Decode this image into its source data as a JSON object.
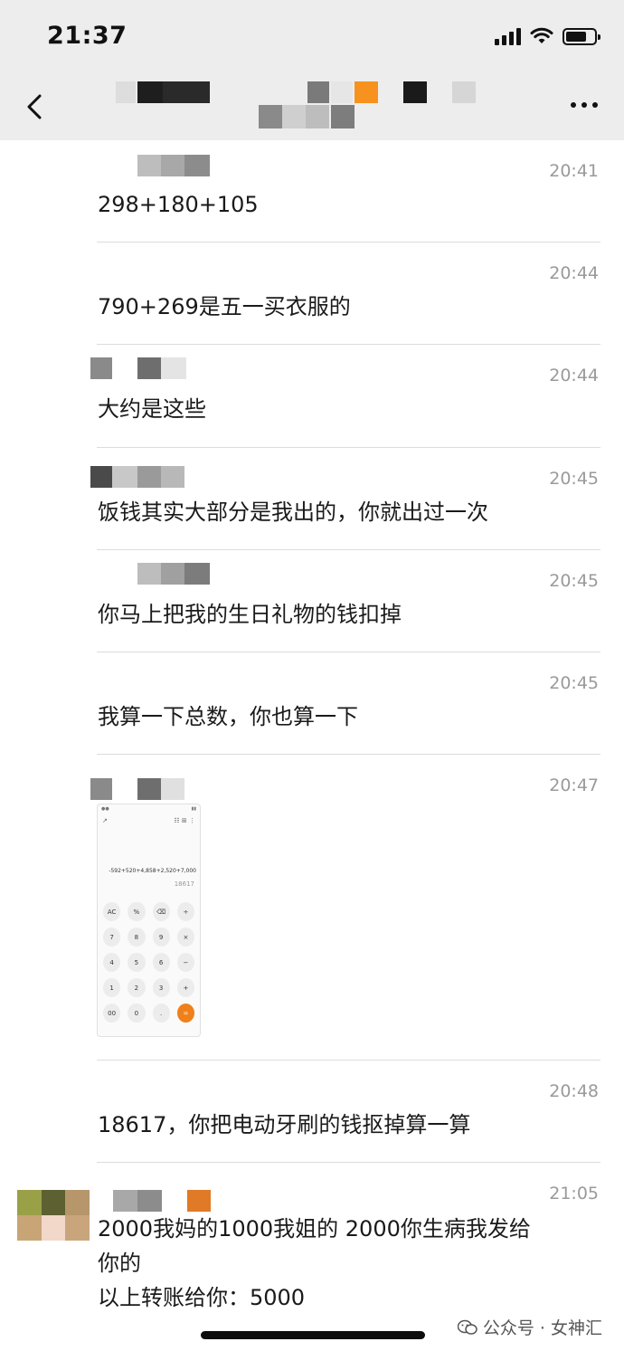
{
  "status_bar": {
    "time": "21:37"
  },
  "nav": {
    "back_icon": "chevron-left-icon",
    "more_icon": "ellipsis-icon"
  },
  "messages": [
    {
      "time": "20:41",
      "text": "298+180+105"
    },
    {
      "time": "20:44",
      "text": "790+269是五一买衣服的"
    },
    {
      "time": "20:44",
      "text": "大约是这些"
    },
    {
      "time": "20:45",
      "text": "饭钱其实大部分是我出的，你就出过一次"
    },
    {
      "time": "20:45",
      "text": "你马上把我的生日礼物的钱扣掉"
    },
    {
      "time": "20:45",
      "text": "我算一下总数，你也算一下"
    },
    {
      "time": "20:47",
      "image": {
        "expression": "-592+520+4,858+2,520+7,000",
        "result": "18617",
        "keys": [
          "AC",
          "%",
          "⌫",
          "÷",
          "7",
          "8",
          "9",
          "×",
          "4",
          "5",
          "6",
          "−",
          "1",
          "2",
          "3",
          "+",
          "00",
          "0",
          ".",
          "="
        ]
      }
    },
    {
      "time": "20:48",
      "text": "18617，你把电动牙刷的钱抠掉算一算"
    },
    {
      "time": "21:05",
      "text": "2000我妈的1000我姐的 2000你生病我发给\n你的\n以上转账给你：5000"
    }
  ],
  "watermark": {
    "text": "公众号 · 女神汇",
    "icon": "wechat-official-account-icon"
  },
  "colors": {
    "bar_bg": "#ededed",
    "timestamp": "#9a9a9a",
    "divider": "#dcdcdc",
    "orange": "#f7921e"
  }
}
